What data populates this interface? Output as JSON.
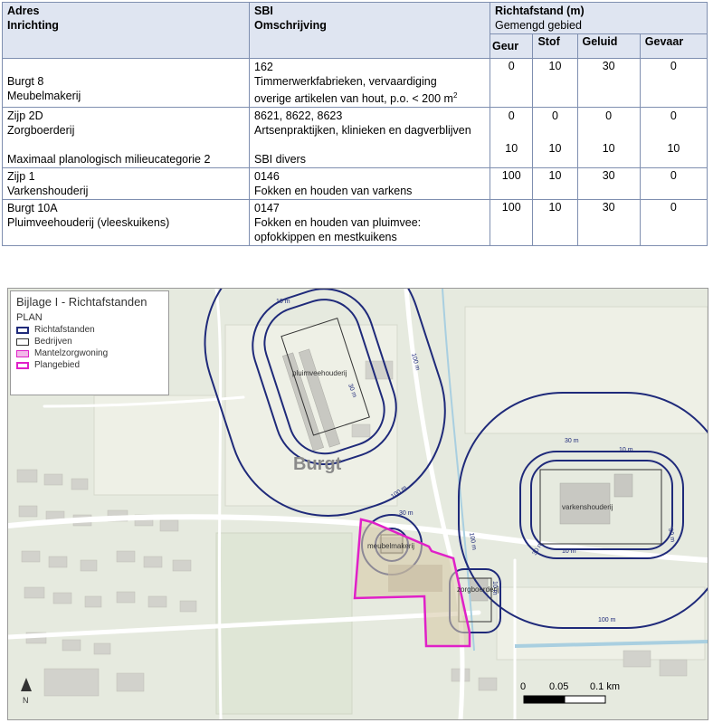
{
  "table": {
    "header": {
      "col1_line1": "Adres",
      "col1_line2": "Inrichting",
      "col2_line1": "SBI",
      "col2_line2": "Omschrijving",
      "group_line1": "Richtafstand (m)",
      "group_line2": "Gemengd gebied",
      "sub": [
        "Geur",
        "Stof",
        "Geluid",
        "Gevaar"
      ]
    },
    "rows": [
      {
        "col1": [
          "Burgt 8",
          "Meubelmakerij"
        ],
        "col2": [
          "162",
          "Timmerwerkfabrieken, vervaardiging",
          "overige artikelen van hout, p.o. < 200 m"
        ],
        "col2_sup": "2",
        "values": [
          "0",
          "10",
          "30",
          "0"
        ]
      },
      {
        "col1": [
          "Zijp 2D",
          "Zorgboerderij",
          "Maximaal planologisch milieucategorie 2"
        ],
        "col2": [
          "8621, 8622, 8623",
          "Artsenpraktijken, klinieken en dagverblijven",
          "SBI divers"
        ],
        "values": [
          "0",
          "0",
          "0",
          "0"
        ],
        "values2": [
          "10",
          "10",
          "10",
          "10"
        ]
      },
      {
        "col1": [
          "Zijp 1",
          "Varkenshouderij"
        ],
        "col2": [
          "0146",
          "Fokken en houden van varkens"
        ],
        "values": [
          "100",
          "10",
          "30",
          "0"
        ]
      },
      {
        "col1": [
          "Burgt 10A",
          "Pluimveehouderij (vleeskuikens)"
        ],
        "col2": [
          "0147",
          "Fokken en houden van pluimvee:",
          "opfokkippen en mestkuikens"
        ],
        "values": [
          "100",
          "10",
          "30",
          "0"
        ]
      }
    ]
  },
  "map": {
    "legend": {
      "title": "Bijlage I - Richtafstanden",
      "plan": "PLAN",
      "items": [
        "Richtafstanden",
        "Bedrijven",
        "Mantelzorgwoning",
        "Plangebied"
      ]
    },
    "place_label": "Burgt",
    "labels": {
      "pluimvee": "pluimveehouderij",
      "varkens": "varkenshouderij",
      "meubel": "meubelmakerij",
      "zorg": "zorgboerderij"
    },
    "distance_labels": {
      "m10": "10 m",
      "m30": "30 m",
      "m100": "100 m"
    },
    "scale": [
      "0",
      "0.05",
      "0.1 km"
    ],
    "north": "N",
    "colors": {
      "contour": "#1f2a7a",
      "plangebied": "#e020c8",
      "water": "#a9cfe0",
      "road": "#ffffff"
    }
  }
}
